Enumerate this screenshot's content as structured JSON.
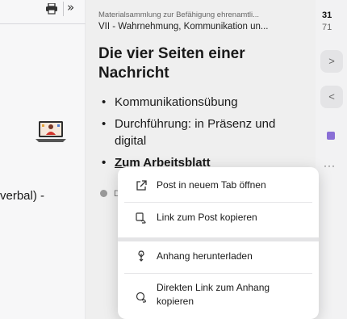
{
  "left_panel": {
    "snippet_text": "verbal) -"
  },
  "post": {
    "source_title": "Materialsammlung zur Befähigung ehrenamtli...",
    "section_title": "VII - Wahrnehmung, Kommunikation un...",
    "heading": "Die vier Seiten einer Nachricht",
    "bullets": [
      "Kommunikationsübung",
      "Durchführung: in Präsenz und digital",
      "Zum Arbeitsblatt"
    ],
    "author_initial": "D"
  },
  "right_rail": {
    "stat_number": "31",
    "stat_sub": "71",
    "next_glyph": ">",
    "prev_glyph": "<",
    "more_glyph": "···"
  },
  "context_menu": {
    "items": [
      {
        "label": "Post in neuem Tab öffnen",
        "icon": "open-external-icon"
      },
      {
        "label": "Link zum Post kopieren",
        "icon": "copy-link-icon"
      },
      {
        "label": "Anhang herunterladen",
        "icon": "download-icon"
      },
      {
        "label": "Direkten Link zum Anhang kopieren",
        "icon": "copy-attachment-link-icon"
      }
    ]
  },
  "colors": {
    "card_bg": "#efefef",
    "menu_bg": "#ffffff",
    "accent_purple": "#8a6fd6"
  }
}
